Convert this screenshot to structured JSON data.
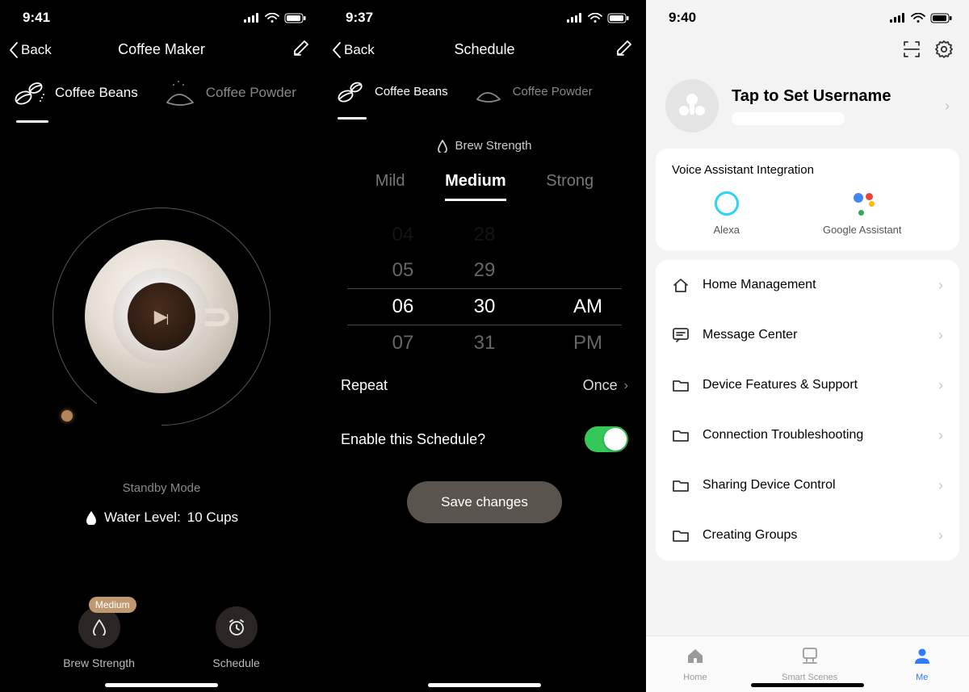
{
  "screen1": {
    "time": "9:41",
    "back": "Back",
    "title": "Coffee Maker",
    "tabs": {
      "beans": "Coffee Beans",
      "powder": "Coffee Powder"
    },
    "status": "Standby Mode",
    "water_label": "Water Level:",
    "water_value": "10 Cups",
    "actions": {
      "brew": {
        "label": "Brew Strength",
        "badge": "Medium"
      },
      "schedule": {
        "label": "Schedule"
      }
    }
  },
  "screen2": {
    "time": "9:37",
    "back": "Back",
    "title": "Schedule",
    "tabs": {
      "beans": "Coffee Beans",
      "powder": "Coffee Powder"
    },
    "brew_title": "Brew Strength",
    "strengths": {
      "mild": "Mild",
      "medium": "Medium",
      "strong": "Strong"
    },
    "picker": {
      "above": {
        "h": "05",
        "m": "29"
      },
      "sel": {
        "h": "06",
        "m": "30",
        "ap": "AM"
      },
      "below": {
        "h": "07",
        "m": "31",
        "ap": "PM"
      }
    },
    "repeat_label": "Repeat",
    "repeat_value": "Once",
    "enable_label": "Enable this Schedule?",
    "save": "Save changes"
  },
  "screen3": {
    "time": "9:40",
    "profile_name": "Tap to Set Username",
    "voice_title": "Voice Assistant Integration",
    "alexa": "Alexa",
    "google": "Google Assistant",
    "items": {
      "home": "Home Management",
      "msg": "Message Center",
      "features": "Device Features & Support",
      "trouble": "Connection Troubleshooting",
      "share": "Sharing Device Control",
      "groups": "Creating Groups"
    },
    "tabbar": {
      "home": "Home",
      "scenes": "Smart Scenes",
      "me": "Me"
    }
  }
}
